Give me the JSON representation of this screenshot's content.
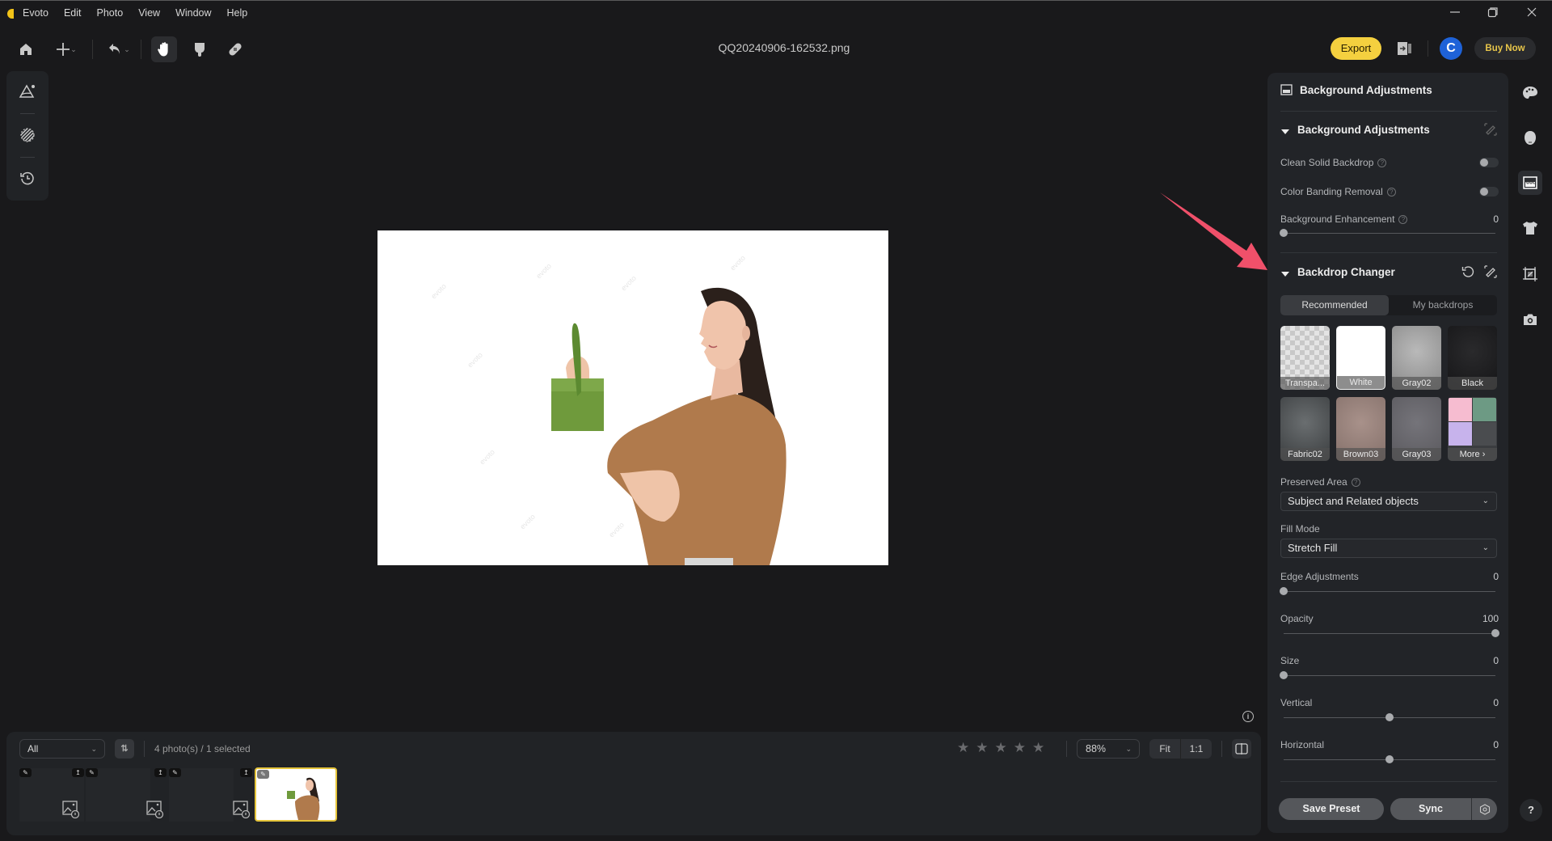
{
  "app": {
    "name": "Evoto",
    "menu": [
      "Edit",
      "Photo",
      "View",
      "Window",
      "Help"
    ],
    "window_controls": {
      "minimize": "minimize-icon",
      "restore": "restore-icon",
      "close": "close-icon"
    }
  },
  "toolbar": {
    "icons": [
      "home-icon",
      "add-icon",
      "undo-icon",
      "hand-icon",
      "pointer-icon",
      "healing-bandage-icon"
    ],
    "filename": "QQ20240906-162532.png",
    "export_label": "Export",
    "avatar_initial": "C",
    "buy_now_label": "Buy Now"
  },
  "left_tools": [
    "adjust-landscape-icon",
    "mask-icon",
    "history-icon"
  ],
  "canvas": {
    "image_description": "Woman in brown sweater holding green gift box on white background",
    "watermark": "evoto"
  },
  "filmstrip": {
    "filter": "All",
    "count_text": "4 photo(s) / 1 selected",
    "photos": [
      {
        "state": "loading",
        "selected": false
      },
      {
        "state": "loading",
        "selected": false
      },
      {
        "state": "loading",
        "selected": false
      },
      {
        "state": "loaded",
        "selected": true
      }
    ],
    "rating_stars": 5,
    "rating_value": 0,
    "zoom": "88%",
    "fit_label": "Fit",
    "one_to_one_label": "1:1"
  },
  "right_panel": {
    "title": "Background Adjustments",
    "section1": {
      "title": "Background Adjustments",
      "clean_solid_backdrop": {
        "label": "Clean Solid Backdrop",
        "on": false
      },
      "color_banding_removal": {
        "label": "Color Banding Removal",
        "on": false
      },
      "background_enhancement": {
        "label": "Background Enhancement",
        "value": "0",
        "min": 0,
        "max": 100,
        "fraction": 0
      }
    },
    "backdrop_changer": {
      "title": "Backdrop Changer",
      "tabs": [
        {
          "label": "Recommended",
          "active": true
        },
        {
          "label": "My backdrops",
          "active": false
        }
      ],
      "swatches": [
        {
          "label": "Transpa...",
          "style": "checker",
          "selected": false
        },
        {
          "label": "White",
          "style": "#ffffff",
          "selected": true
        },
        {
          "label": "Gray02",
          "style": "#9c9c9c",
          "selected": false
        },
        {
          "label": "Black",
          "style": "#1d1d1f",
          "selected": false
        },
        {
          "label": "Fabric02",
          "style": "#4d5153",
          "selected": false
        },
        {
          "label": "Brown03",
          "style": "#9a847c",
          "selected": false
        },
        {
          "label": "Gray03",
          "style": "#68676c",
          "selected": false
        },
        {
          "label": "More ›",
          "style": "grid",
          "selected": false
        }
      ],
      "preserved_area_label": "Preserved Area",
      "preserved_area_value": "Subject and Related objects",
      "fill_mode_label": "Fill Mode",
      "fill_mode_value": "Stretch Fill",
      "sliders": [
        {
          "label": "Edge Adjustments",
          "value": "0",
          "fraction": 0
        },
        {
          "label": "Opacity",
          "value": "100",
          "fraction": 1
        },
        {
          "label": "Size",
          "value": "0",
          "fraction": 0
        },
        {
          "label": "Vertical",
          "value": "0",
          "fraction": 0.5
        },
        {
          "label": "Horizontal",
          "value": "0",
          "fraction": 0.5
        }
      ]
    },
    "save_preset_label": "Save Preset",
    "sync_label": "Sync"
  },
  "right_rail": [
    "palette-icon",
    "face-icon",
    "background-icon",
    "clothing-icon",
    "crop-icon",
    "camera-icon"
  ],
  "help_label": "?",
  "colors": {
    "accent_yellow": "#f4d03f",
    "avatar_blue": "#1e62d8",
    "annotation_red": "#f0506a"
  }
}
